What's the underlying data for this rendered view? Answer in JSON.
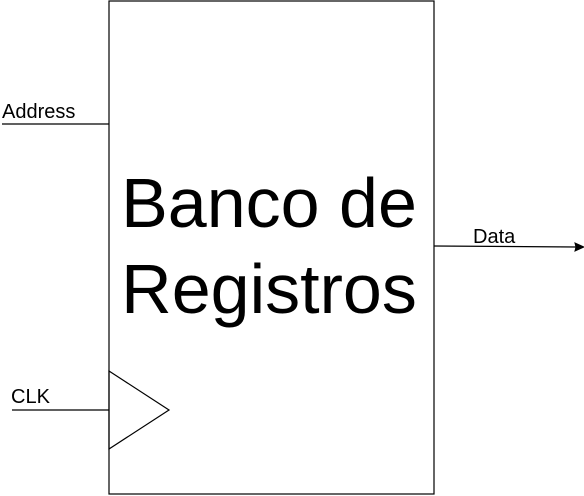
{
  "block": {
    "title_line1": "Banco de",
    "title_line2": "Registros"
  },
  "ports": {
    "address": "Address",
    "clk": "CLK",
    "data": "Data"
  },
  "colors": {
    "stroke": "#000000",
    "background": "#ffffff"
  }
}
